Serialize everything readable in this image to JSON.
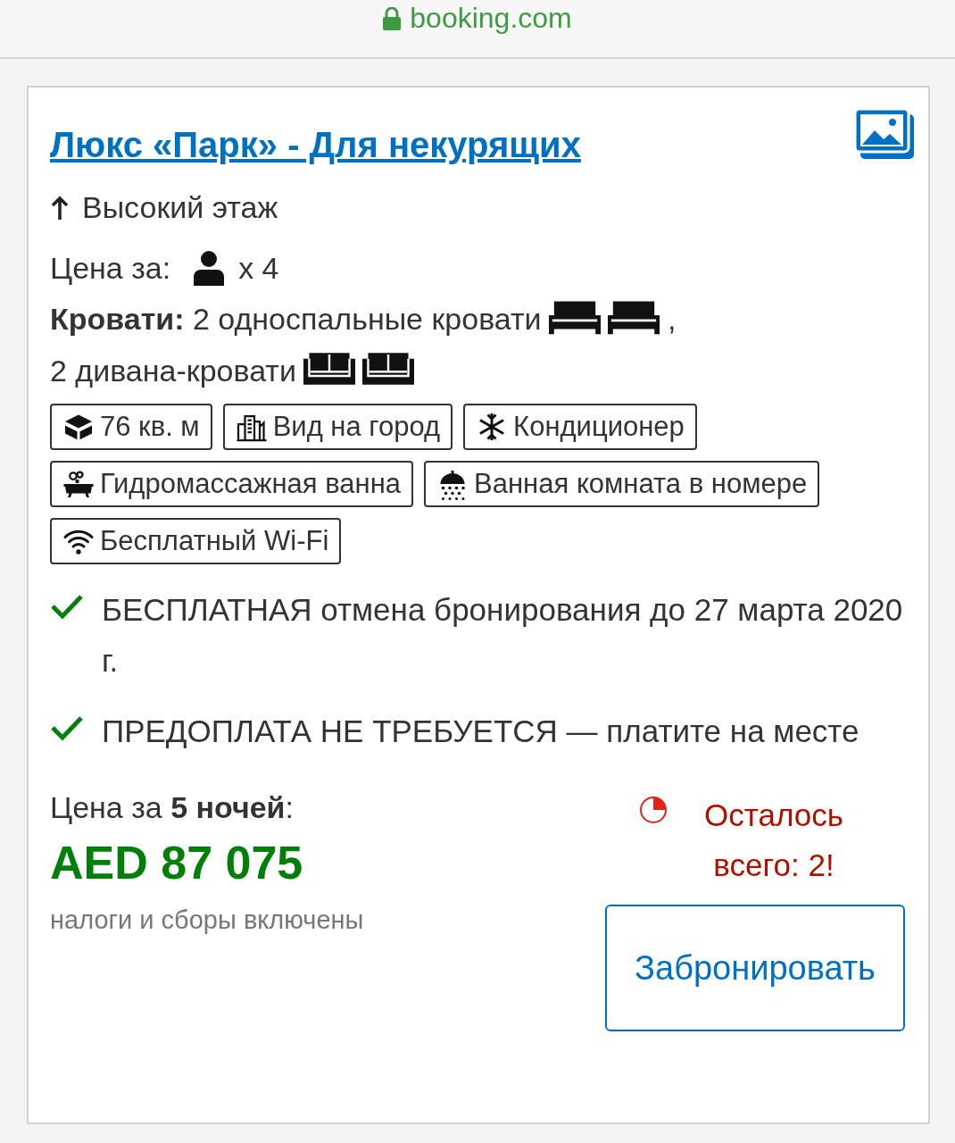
{
  "address_bar": {
    "secure": true,
    "url": "booking.com"
  },
  "room": {
    "title": "Люкс «Парк» - Для некурящих",
    "floor": "Высокий этаж",
    "price_for": {
      "label": "Цена за:",
      "guests": "x 4"
    },
    "beds": {
      "label": "Кровати:",
      "separator": ",",
      "groups": [
        {
          "text": "2 односпальные кровати",
          "icons": [
            {
              "kind": "bed"
            },
            {
              "kind": "bed"
            }
          ]
        },
        {
          "text": "2 дивана-кровати",
          "icons": [
            {
              "kind": "sofa"
            },
            {
              "kind": "sofa"
            }
          ]
        }
      ]
    },
    "facilities": [
      {
        "kind": "area",
        "text": "76 кв. м"
      },
      {
        "kind": "city",
        "text": "Вид на город"
      },
      {
        "kind": "snow",
        "text": "Кондиционер"
      },
      {
        "kind": "bath",
        "text": "Гидромассажная ванна"
      },
      {
        "kind": "shower",
        "text": "Ванная комната в номере"
      },
      {
        "kind": "wifi",
        "text": "Бесплатный Wi-Fi"
      }
    ],
    "conditions": [
      {
        "text": "БЕСПЛАТНАЯ отмена бронирования до 27 марта 2020 г."
      },
      {
        "text": "ПРЕДОПЛАТА НЕ ТРЕБУЕТСЯ — платите на месте"
      }
    ],
    "price": {
      "label": "Цена за **5 ночей**:",
      "amount": "AED 87 075",
      "note": "налоги и сборы включены"
    },
    "scarcity": "Осталось всего: 2!",
    "book_button": "Забронировать"
  }
}
